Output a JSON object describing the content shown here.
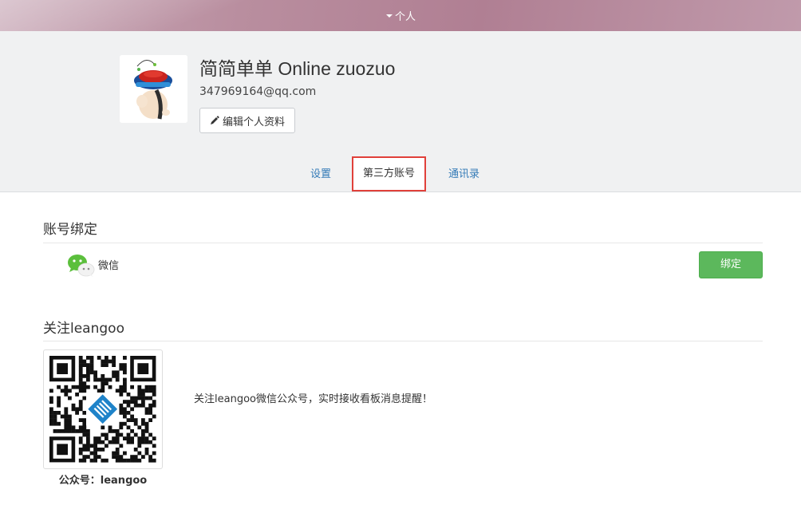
{
  "topbar": {
    "menu_label": "个人"
  },
  "profile": {
    "username": "简简单单 Online zuozuo",
    "email": "347969164@qq.com",
    "edit_label": "编辑个人资料"
  },
  "tabs": [
    {
      "label": "设置",
      "active": false
    },
    {
      "label": "第三方账号",
      "active": true
    },
    {
      "label": "通讯录",
      "active": false
    }
  ],
  "binding": {
    "title": "账号绑定",
    "items": [
      {
        "name": "微信",
        "icon": "wechat-icon",
        "action_label": "绑定"
      }
    ]
  },
  "follow": {
    "title": "关注leangoo",
    "qr_caption": "公众号：leangoo",
    "description": "关注leangoo微信公众号，实时接收看板消息提醒！"
  },
  "colors": {
    "link": "#337ab7",
    "success": "#5cb85c",
    "active_tab_border": "#e0403a",
    "header_bg": "#f0f1f2"
  }
}
